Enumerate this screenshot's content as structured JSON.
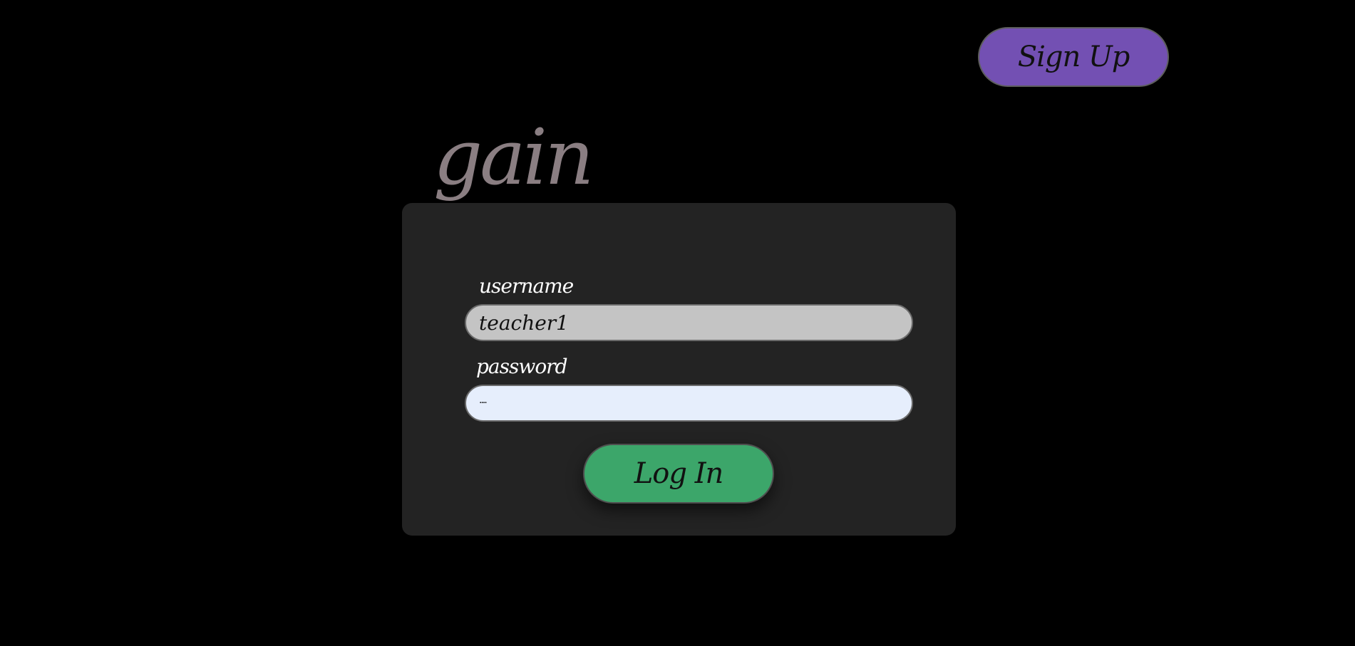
{
  "header": {
    "signup_label": "Sign Up"
  },
  "brand": {
    "logo_text": "gain"
  },
  "login_form": {
    "username_label": "username",
    "username_value": "teacher1",
    "password_label": "password",
    "password_masked": "····",
    "login_label": "Log In"
  },
  "colors": {
    "background": "#000000",
    "card": "#232323",
    "signup_button": "#7350b3",
    "login_button": "#3ca66a",
    "logo": "#8a7e82",
    "username_field": "#c4c4c4",
    "password_field": "#e6eefc"
  }
}
